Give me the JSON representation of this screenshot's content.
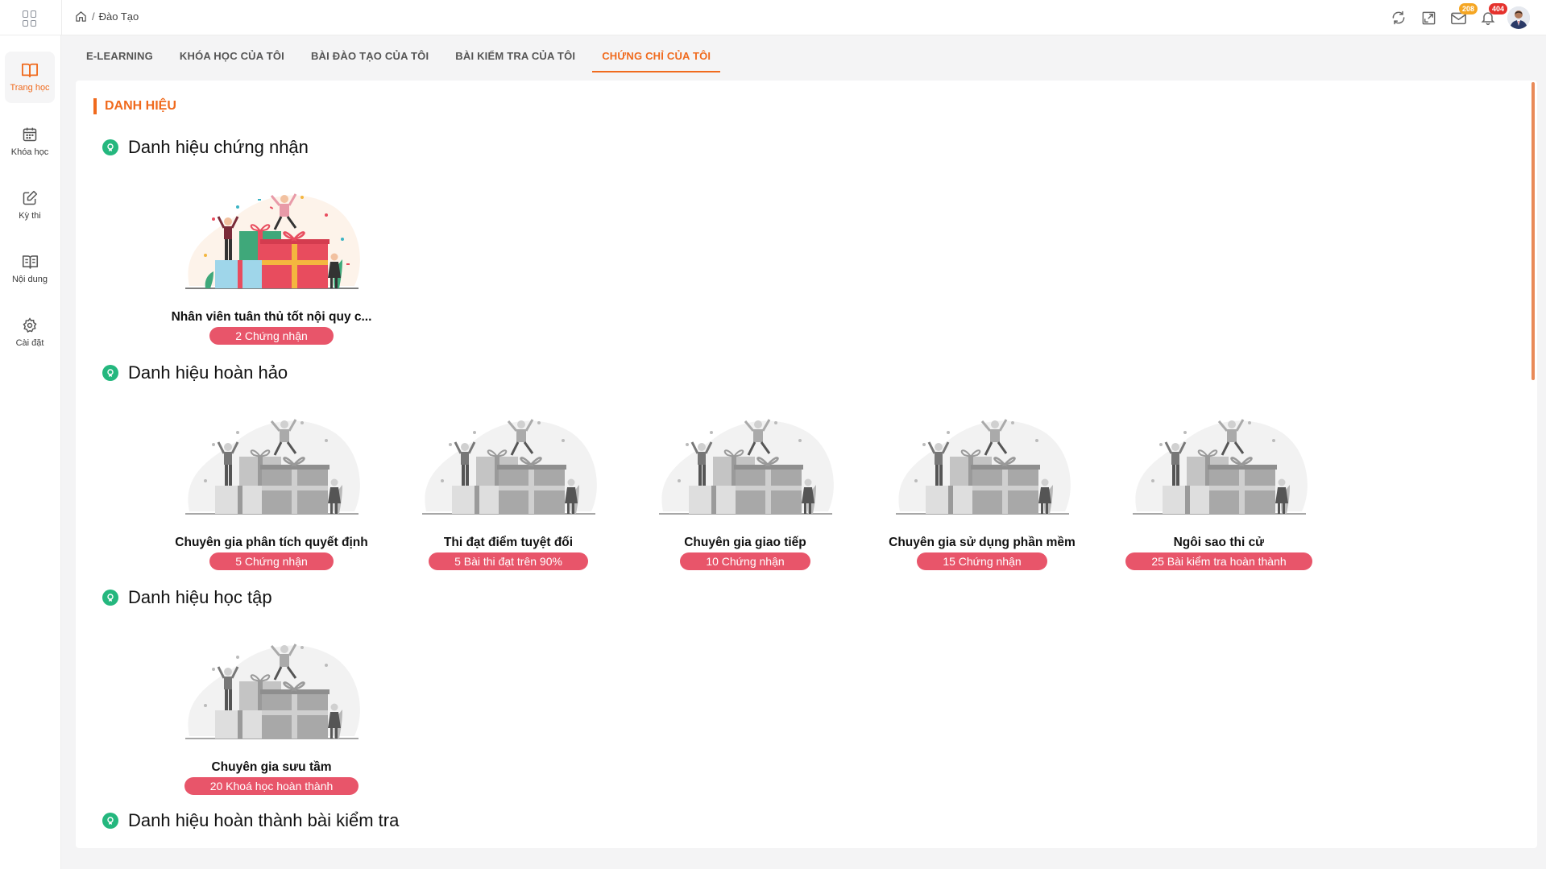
{
  "breadcrumb": {
    "separator": "/",
    "current": "Đào Tạo"
  },
  "badges": {
    "mail": "208",
    "notifications": "404"
  },
  "sidebar": {
    "items": [
      {
        "label": "Trang học",
        "icon": "book-open-icon"
      },
      {
        "label": "Khóa học",
        "icon": "calendar-icon"
      },
      {
        "label": "Kỳ thi",
        "icon": "edit-icon"
      },
      {
        "label": "Nội dung",
        "icon": "content-book-icon"
      },
      {
        "label": "Cài đặt",
        "icon": "gear-icon"
      }
    ]
  },
  "tabs": [
    {
      "label": "E-LEARNING"
    },
    {
      "label": "KHÓA HỌC CỦA TÔI"
    },
    {
      "label": "BÀI ĐÀO TẠO CỦA TÔI"
    },
    {
      "label": "BÀI KIỂM TRA CỦA TÔI"
    },
    {
      "label": "CHỨNG CHỈ CỦA TÔI",
      "active": true
    }
  ],
  "page_title": "DANH HIỆU",
  "sections": [
    {
      "title": "Danh hiệu chứng nhận",
      "cards": [
        {
          "name": "Nhân viên tuân thủ tốt nội quy c...",
          "requirement": "2 Chứng nhận",
          "achieved": true
        }
      ]
    },
    {
      "title": "Danh hiệu hoàn hảo",
      "cards": [
        {
          "name": "Chuyên gia phân tích quyết định",
          "requirement": "5 Chứng nhận",
          "achieved": false
        },
        {
          "name": "Thi đạt điểm tuyệt đối",
          "requirement": "5 Bài thi đạt trên 90%",
          "achieved": false
        },
        {
          "name": "Chuyên gia giao tiếp",
          "requirement": "10 Chứng nhận",
          "achieved": false
        },
        {
          "name": "Chuyên gia sử dụng phần mềm",
          "requirement": "15 Chứng nhận",
          "achieved": false
        },
        {
          "name": "Ngôi sao thi cử",
          "requirement": "25 Bài kiểm tra hoàn thành",
          "achieved": false
        }
      ]
    },
    {
      "title": "Danh hiệu học tập",
      "cards": [
        {
          "name": "Chuyên gia sưu tầm",
          "requirement": "20 Khoá học hoàn thành",
          "achieved": false
        }
      ]
    },
    {
      "title": "Danh hiệu hoàn thành bài kiểm tra",
      "cards": []
    }
  ],
  "colors": {
    "accent": "#f06a1d",
    "pill": "#e8556a",
    "section_icon": "#24b77e"
  }
}
